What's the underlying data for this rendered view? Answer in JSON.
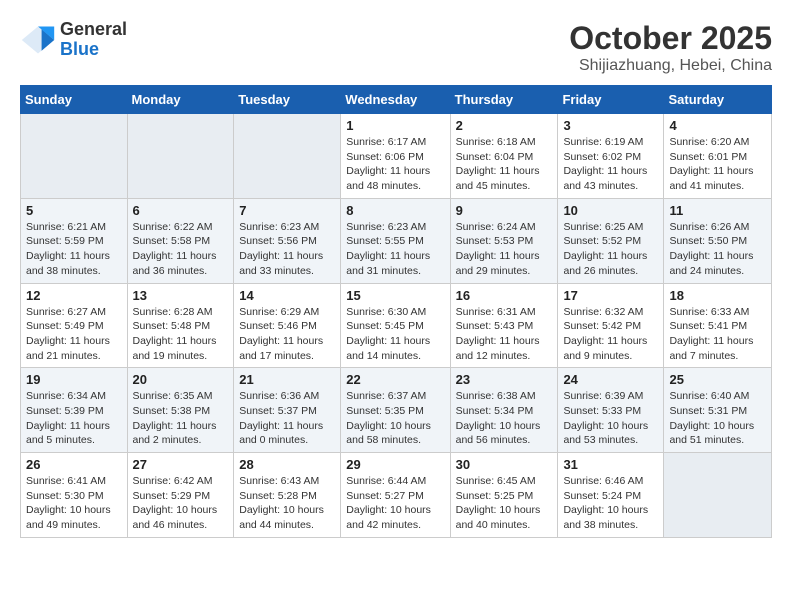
{
  "header": {
    "logo": {
      "general": "General",
      "blue": "Blue"
    },
    "title": "October 2025",
    "subtitle": "Shijiazhuang, Hebei, China"
  },
  "weekdays": [
    "Sunday",
    "Monday",
    "Tuesday",
    "Wednesday",
    "Thursday",
    "Friday",
    "Saturday"
  ],
  "weeks": [
    [
      {
        "day": "",
        "info": ""
      },
      {
        "day": "",
        "info": ""
      },
      {
        "day": "",
        "info": ""
      },
      {
        "day": "1",
        "info": "Sunrise: 6:17 AM\nSunset: 6:06 PM\nDaylight: 11 hours\nand 48 minutes."
      },
      {
        "day": "2",
        "info": "Sunrise: 6:18 AM\nSunset: 6:04 PM\nDaylight: 11 hours\nand 45 minutes."
      },
      {
        "day": "3",
        "info": "Sunrise: 6:19 AM\nSunset: 6:02 PM\nDaylight: 11 hours\nand 43 minutes."
      },
      {
        "day": "4",
        "info": "Sunrise: 6:20 AM\nSunset: 6:01 PM\nDaylight: 11 hours\nand 41 minutes."
      }
    ],
    [
      {
        "day": "5",
        "info": "Sunrise: 6:21 AM\nSunset: 5:59 PM\nDaylight: 11 hours\nand 38 minutes."
      },
      {
        "day": "6",
        "info": "Sunrise: 6:22 AM\nSunset: 5:58 PM\nDaylight: 11 hours\nand 36 minutes."
      },
      {
        "day": "7",
        "info": "Sunrise: 6:23 AM\nSunset: 5:56 PM\nDaylight: 11 hours\nand 33 minutes."
      },
      {
        "day": "8",
        "info": "Sunrise: 6:23 AM\nSunset: 5:55 PM\nDaylight: 11 hours\nand 31 minutes."
      },
      {
        "day": "9",
        "info": "Sunrise: 6:24 AM\nSunset: 5:53 PM\nDaylight: 11 hours\nand 29 minutes."
      },
      {
        "day": "10",
        "info": "Sunrise: 6:25 AM\nSunset: 5:52 PM\nDaylight: 11 hours\nand 26 minutes."
      },
      {
        "day": "11",
        "info": "Sunrise: 6:26 AM\nSunset: 5:50 PM\nDaylight: 11 hours\nand 24 minutes."
      }
    ],
    [
      {
        "day": "12",
        "info": "Sunrise: 6:27 AM\nSunset: 5:49 PM\nDaylight: 11 hours\nand 21 minutes."
      },
      {
        "day": "13",
        "info": "Sunrise: 6:28 AM\nSunset: 5:48 PM\nDaylight: 11 hours\nand 19 minutes."
      },
      {
        "day": "14",
        "info": "Sunrise: 6:29 AM\nSunset: 5:46 PM\nDaylight: 11 hours\nand 17 minutes."
      },
      {
        "day": "15",
        "info": "Sunrise: 6:30 AM\nSunset: 5:45 PM\nDaylight: 11 hours\nand 14 minutes."
      },
      {
        "day": "16",
        "info": "Sunrise: 6:31 AM\nSunset: 5:43 PM\nDaylight: 11 hours\nand 12 minutes."
      },
      {
        "day": "17",
        "info": "Sunrise: 6:32 AM\nSunset: 5:42 PM\nDaylight: 11 hours\nand 9 minutes."
      },
      {
        "day": "18",
        "info": "Sunrise: 6:33 AM\nSunset: 5:41 PM\nDaylight: 11 hours\nand 7 minutes."
      }
    ],
    [
      {
        "day": "19",
        "info": "Sunrise: 6:34 AM\nSunset: 5:39 PM\nDaylight: 11 hours\nand 5 minutes."
      },
      {
        "day": "20",
        "info": "Sunrise: 6:35 AM\nSunset: 5:38 PM\nDaylight: 11 hours\nand 2 minutes."
      },
      {
        "day": "21",
        "info": "Sunrise: 6:36 AM\nSunset: 5:37 PM\nDaylight: 11 hours\nand 0 minutes."
      },
      {
        "day": "22",
        "info": "Sunrise: 6:37 AM\nSunset: 5:35 PM\nDaylight: 10 hours\nand 58 minutes."
      },
      {
        "day": "23",
        "info": "Sunrise: 6:38 AM\nSunset: 5:34 PM\nDaylight: 10 hours\nand 56 minutes."
      },
      {
        "day": "24",
        "info": "Sunrise: 6:39 AM\nSunset: 5:33 PM\nDaylight: 10 hours\nand 53 minutes."
      },
      {
        "day": "25",
        "info": "Sunrise: 6:40 AM\nSunset: 5:31 PM\nDaylight: 10 hours\nand 51 minutes."
      }
    ],
    [
      {
        "day": "26",
        "info": "Sunrise: 6:41 AM\nSunset: 5:30 PM\nDaylight: 10 hours\nand 49 minutes."
      },
      {
        "day": "27",
        "info": "Sunrise: 6:42 AM\nSunset: 5:29 PM\nDaylight: 10 hours\nand 46 minutes."
      },
      {
        "day": "28",
        "info": "Sunrise: 6:43 AM\nSunset: 5:28 PM\nDaylight: 10 hours\nand 44 minutes."
      },
      {
        "day": "29",
        "info": "Sunrise: 6:44 AM\nSunset: 5:27 PM\nDaylight: 10 hours\nand 42 minutes."
      },
      {
        "day": "30",
        "info": "Sunrise: 6:45 AM\nSunset: 5:25 PM\nDaylight: 10 hours\nand 40 minutes."
      },
      {
        "day": "31",
        "info": "Sunrise: 6:46 AM\nSunset: 5:24 PM\nDaylight: 10 hours\nand 38 minutes."
      },
      {
        "day": "",
        "info": ""
      }
    ]
  ]
}
